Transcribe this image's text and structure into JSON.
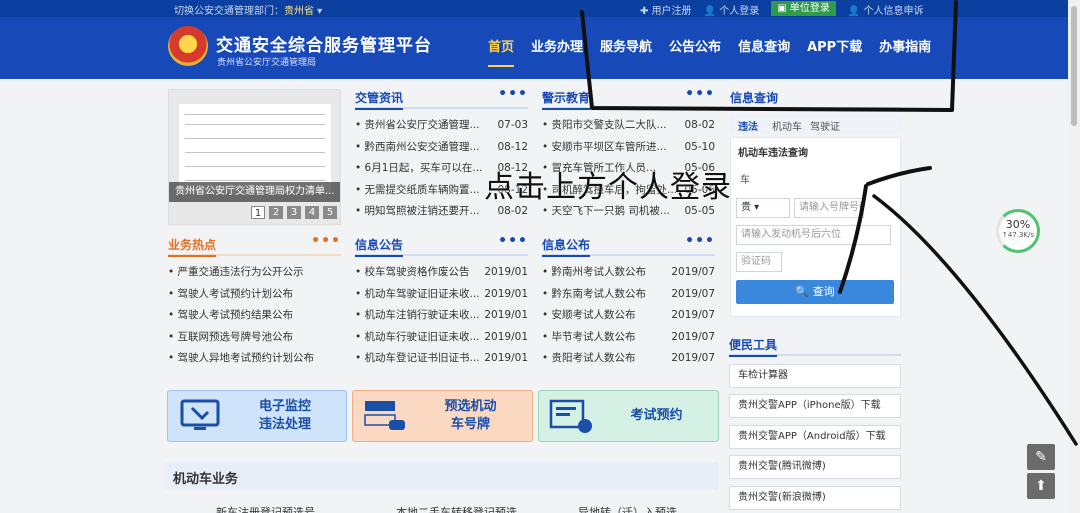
{
  "topbar": {
    "switch_label": "切换公安交通管理部门：",
    "province": "贵州省",
    "links": [
      "用户注册",
      "个人登录",
      "单位登录",
      "个人信息申诉"
    ]
  },
  "header": {
    "title": "交通安全综合服务管理平台",
    "subtitle": "贵州省公安厅交通管理局",
    "nav": [
      "首页",
      "业务办理",
      "服务导航",
      "公告公布",
      "信息查询",
      "APP下载",
      "办事指南"
    ]
  },
  "slide": {
    "caption": "贵州省公安厅交通管理局权力清单...",
    "pages": [
      "1",
      "2",
      "3",
      "4",
      "5"
    ]
  },
  "panels": {
    "news": {
      "title": "交管资讯",
      "items": [
        {
          "t": "• 贵州省公安厅交通管理...",
          "d": "07-03"
        },
        {
          "t": "• 黔西南州公安交通管理...",
          "d": "08-12"
        },
        {
          "t": "• 6月1日起，买车可以在...",
          "d": "08-12"
        },
        {
          "t": "• 无需提交纸质车辆购置...",
          "d": "08-12"
        },
        {
          "t": "• 明知驾照被注销还要开...",
          "d": "08-02"
        }
      ]
    },
    "warning": {
      "title": "警示教育",
      "items": [
        {
          "t": "• 贵阳市交警支队二大队...",
          "d": "08-02"
        },
        {
          "t": "• 安顺市平坝区车管所进...",
          "d": "05-10"
        },
        {
          "t": "• 冒充车管所工作人员...",
          "d": "05-06"
        },
        {
          "t": "• 司机醉驾撞车后，拘留处...",
          "d": "05-05"
        },
        {
          "t": "• 天空飞下一只鹅 司机被...",
          "d": "05-05"
        }
      ]
    },
    "hot": {
      "title": "业务热点",
      "items": [
        {
          "t": "• 严重交通违法行为公开公示",
          "d": ""
        },
        {
          "t": "• 驾驶人考试预约计划公布",
          "d": ""
        },
        {
          "t": "• 驾驶人考试预约结果公布",
          "d": ""
        },
        {
          "t": "• 互联网预选号牌号池公布",
          "d": ""
        },
        {
          "t": "• 驾驶人异地考试预约计划公布",
          "d": ""
        }
      ]
    },
    "notice": {
      "title": "信息公告",
      "items": [
        {
          "t": "• 校车驾驶资格作废公告",
          "d": "2019/01"
        },
        {
          "t": "• 机动车驾驶证旧证未收...",
          "d": "2019/01"
        },
        {
          "t": "• 机动车注销行驶证未收...",
          "d": "2019/01"
        },
        {
          "t": "• 机动车行驶证旧证未收...",
          "d": "2019/01"
        },
        {
          "t": "• 机动车登记证书旧证书...",
          "d": "2019/01"
        }
      ]
    },
    "publish": {
      "title": "信息公布",
      "items": [
        {
          "t": "• 黔南州考试人数公布",
          "d": "2019/07"
        },
        {
          "t": "• 黔东南考试人数公布",
          "d": "2019/07"
        },
        {
          "t": "• 安顺考试人数公布",
          "d": "2019/07"
        },
        {
          "t": "• 毕节考试人数公布",
          "d": "2019/07"
        },
        {
          "t": "• 贵阳考试人数公布",
          "d": "2019/07"
        }
      ]
    },
    "more": "•••"
  },
  "buttons": {
    "monitor": {
      "line1": "电子监控",
      "line2": "违法处理"
    },
    "plate": {
      "line1": "预选机动",
      "line2": "车号牌"
    },
    "exam": {
      "line1": "考试预约"
    }
  },
  "section": {
    "title": "机动车业务",
    "items": [
      "新车注册登记预选号",
      "本地二手车转移登记预选",
      "异地转（迁）入预选"
    ]
  },
  "query": {
    "title": "信息查询",
    "tabs": [
      "违法",
      "机动车",
      "驾驶证"
    ],
    "sub_title": "机动车违法查询",
    "plate_type_label": "车",
    "province_select": "贵",
    "plate_placeholder": "请输入号牌号码",
    "engine_placeholder": "请输入发动机号后六位",
    "captcha_placeholder": "验证码",
    "button": "查询"
  },
  "tools": {
    "title": "便民工具",
    "items": [
      "车检计算器",
      "贵州交警APP（iPhone版）下载",
      "贵州交警APP（Android版）下载",
      "贵州交警(腾讯微博)",
      "贵州交警(新浪微博)"
    ]
  },
  "speed": {
    "pct": "30%",
    "rate": "↑47.3K/s"
  },
  "overlay": {
    "text": "点击上方个人登录"
  },
  "colors": {
    "header": "#1749b8",
    "accent_orange": "#e67020",
    "nav_active": "#ffd34d"
  }
}
